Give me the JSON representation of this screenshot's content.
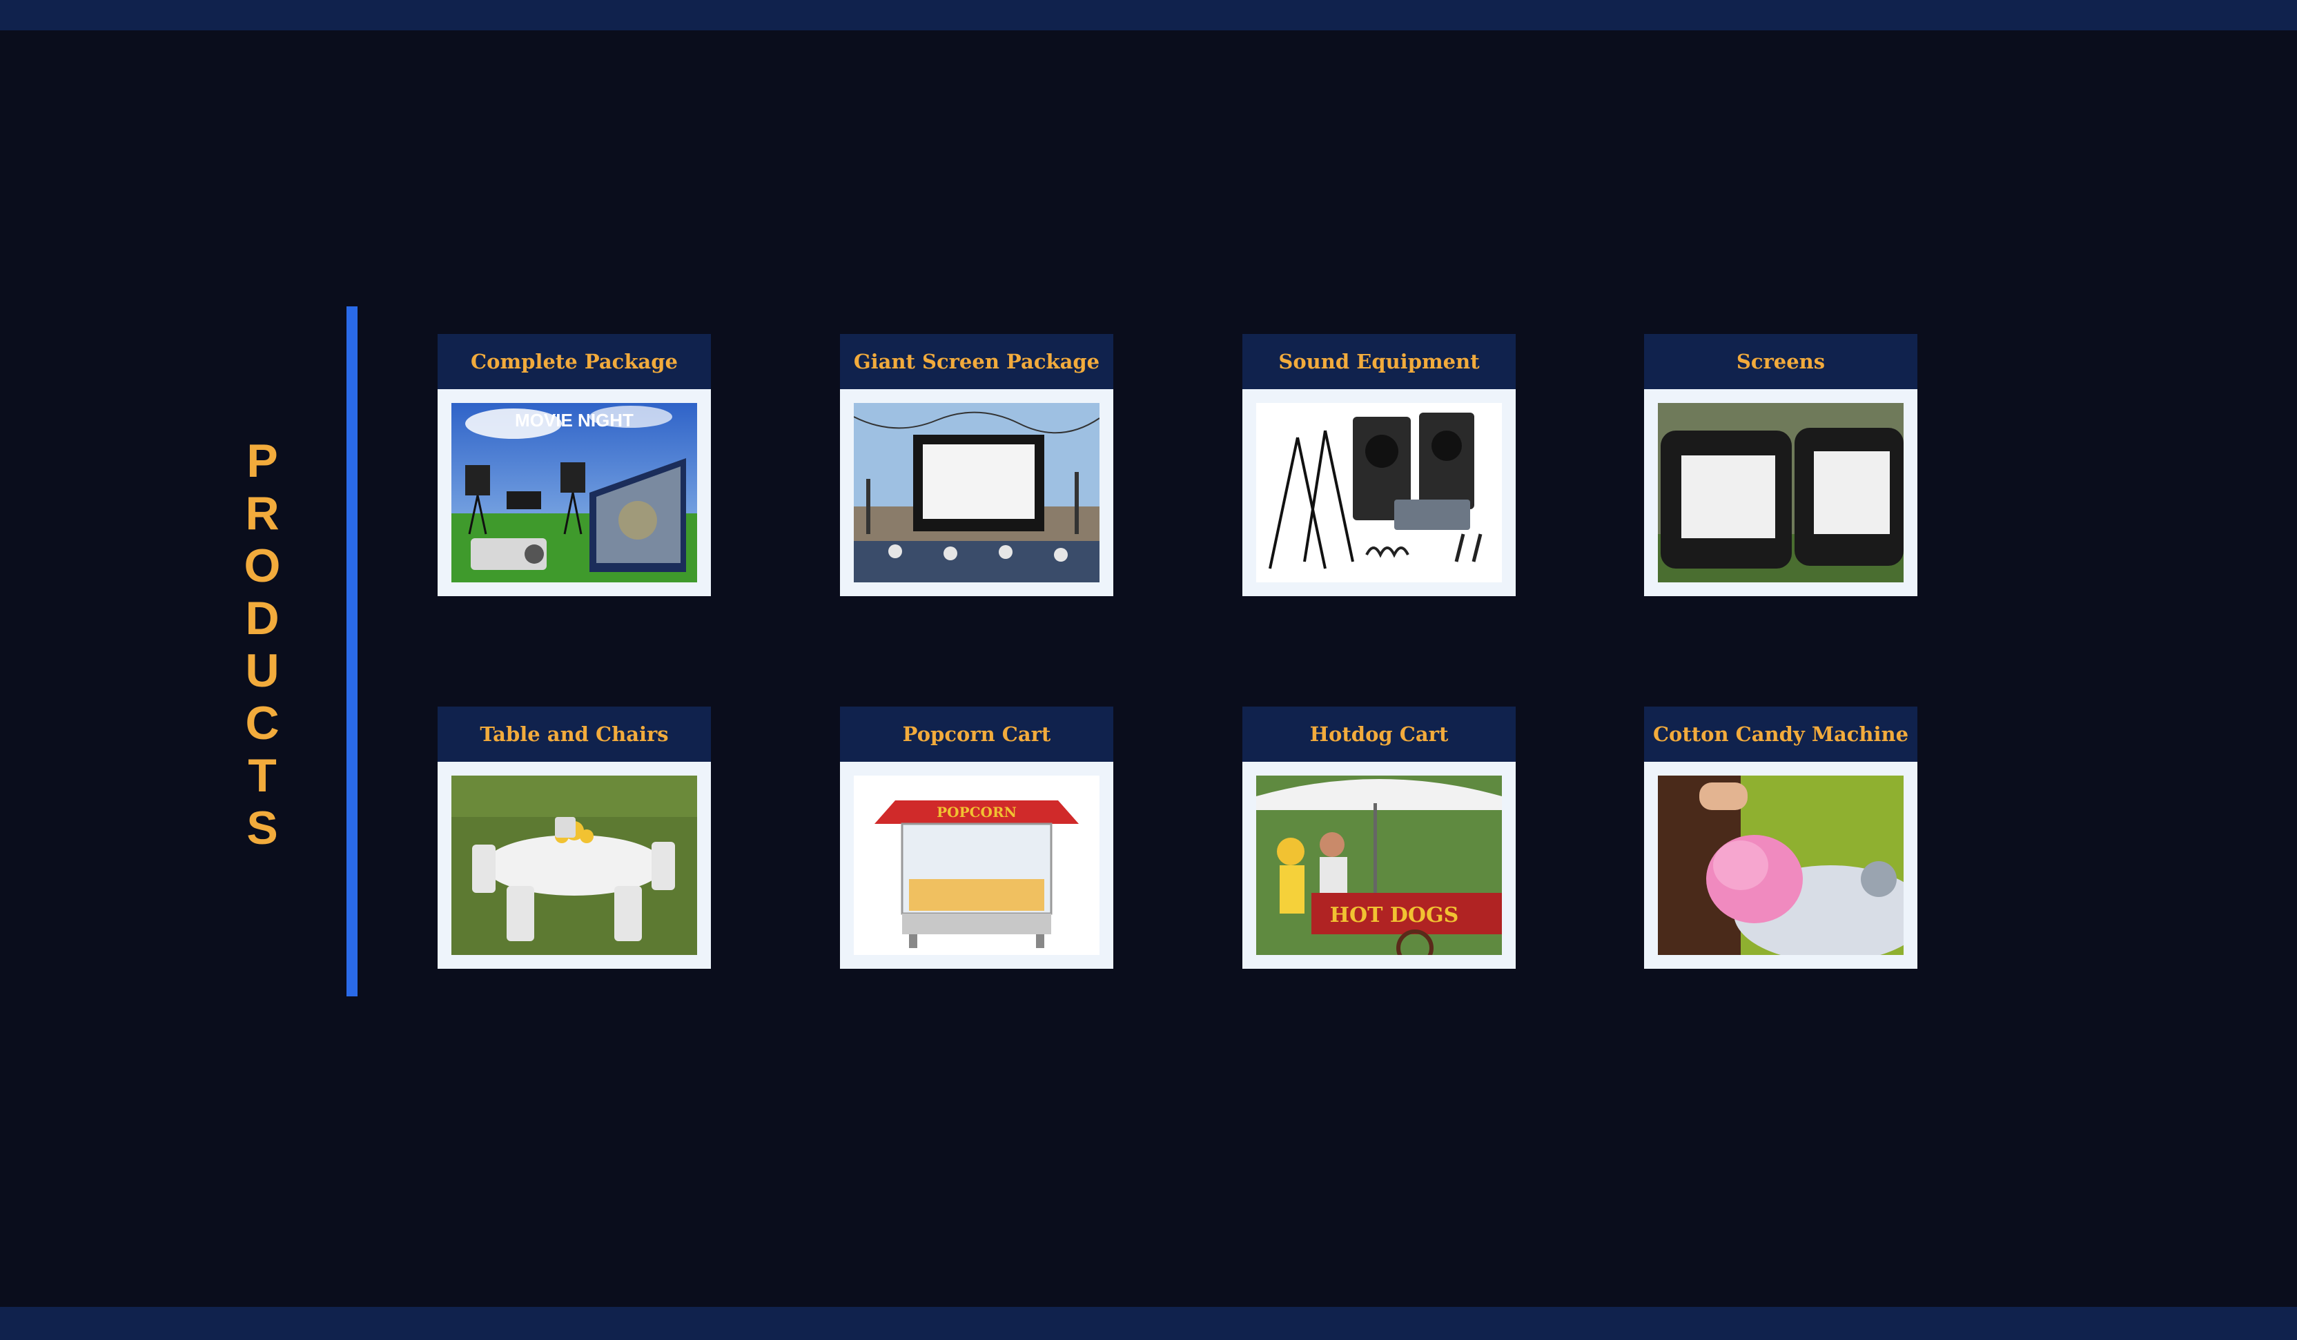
{
  "section": {
    "letters": [
      "P",
      "R",
      "O",
      "D",
      "U",
      "C",
      "T",
      "S"
    ],
    "title_color": "#f2ab3c",
    "accent_color": "#2a6ae8"
  },
  "products": [
    {
      "label": "Complete Package",
      "image": "movie-night-package-photo",
      "image_text": "MOVIE NIGHT"
    },
    {
      "label": "Giant Screen Package",
      "image": "outdoor-giant-screen-photo"
    },
    {
      "label": "Sound Equipment",
      "image": "speakers-and-mixer-photo"
    },
    {
      "label": "Screens",
      "image": "inflatable-screens-photo"
    },
    {
      "label": "Table and Chairs",
      "image": "round-table-chairs-photo"
    },
    {
      "label": "Popcorn Cart",
      "image": "popcorn-cart-photo",
      "image_text": "POPCORN"
    },
    {
      "label": "Hotdog Cart",
      "image": "hotdog-cart-photo",
      "image_text": "HOT DOGS"
    },
    {
      "label": "Cotton Candy Machine",
      "image": "cotton-candy-photo"
    }
  ],
  "colors": {
    "background": "#0a0d1c",
    "bar": "#10224d",
    "card": "#eef4fb"
  }
}
